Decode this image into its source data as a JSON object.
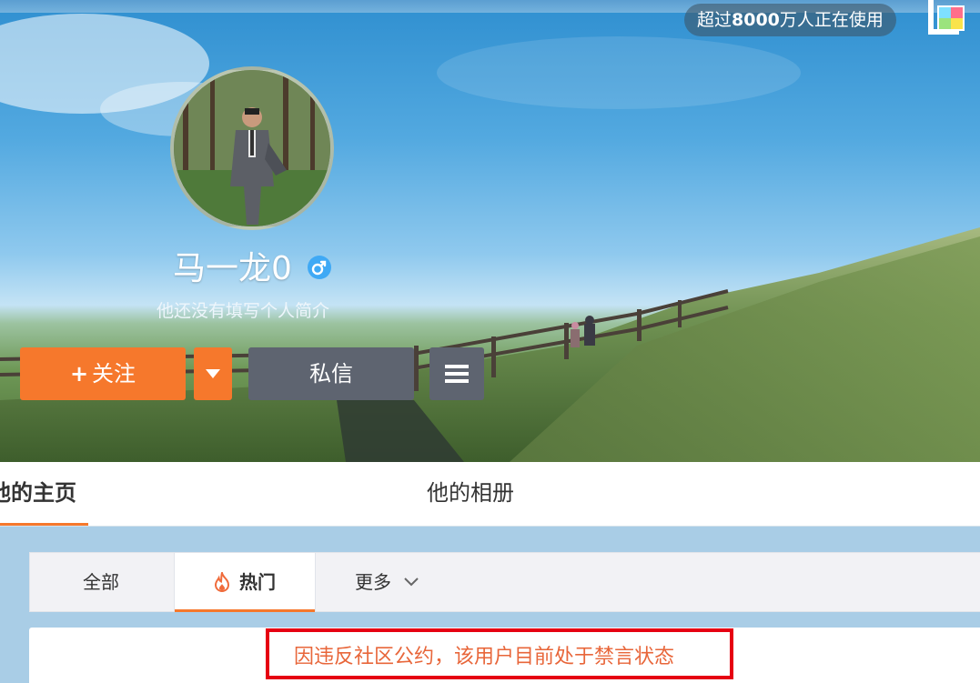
{
  "cover": {
    "users_prefix": "超过",
    "users_count": "8000",
    "users_suffix": "万人正在使用"
  },
  "profile": {
    "name": "马一龙0",
    "gender_icon": "male-icon",
    "bio": "他还没有填写个人简介"
  },
  "actions": {
    "follow_plus": "+",
    "follow_label": "关注",
    "message_label": "私信"
  },
  "nav": {
    "home_tab": "他的主页",
    "album_tab": "他的相册"
  },
  "filter": {
    "all": "全部",
    "hot": "热门",
    "more": "更多"
  },
  "notice": {
    "text": "因违反社区公约，该用户目前处于禁言状态"
  },
  "colors": {
    "accent": "#f6782c",
    "notice_border": "#e60012",
    "notice_text": "#e8663a"
  }
}
